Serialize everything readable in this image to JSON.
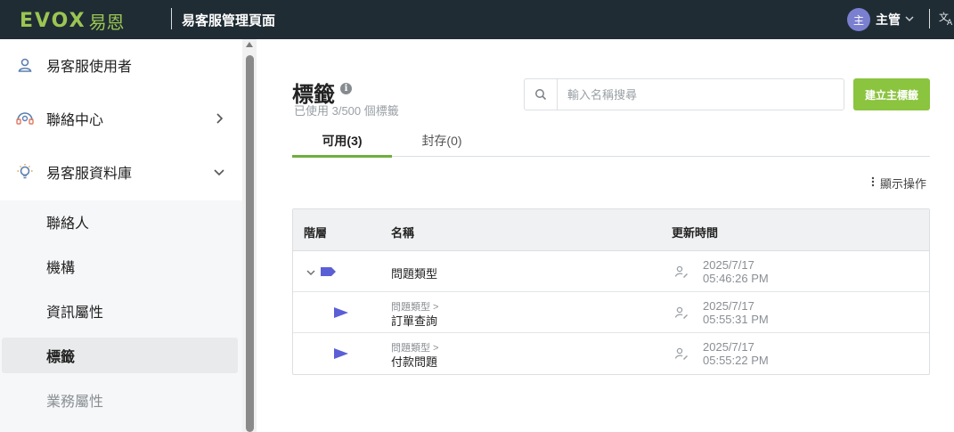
{
  "header": {
    "logo_brand": "EVOX",
    "logo_cn": "易恩",
    "app_title": "易客服管理頁面",
    "user_initial": "主",
    "user_name": "主管"
  },
  "sidebar": {
    "items": [
      {
        "label": "易客服使用者",
        "icon": "user-icon"
      },
      {
        "label": "聯絡中心",
        "icon": "headset-icon",
        "expandable": true,
        "expanded": false
      },
      {
        "label": "易客服資料庫",
        "icon": "lightbulb-icon",
        "expandable": true,
        "expanded": true
      }
    ],
    "subitems": [
      {
        "label": "聯絡人",
        "active": false
      },
      {
        "label": "機構",
        "active": false
      },
      {
        "label": "資訊屬性",
        "active": false
      },
      {
        "label": "標籤",
        "active": true
      },
      {
        "label": "業務屬性",
        "active": false,
        "muted": true
      }
    ]
  },
  "main": {
    "title": "標籤",
    "usage_text": "已使用 3/500 個標籤",
    "search_placeholder": "輸入名稱搜尋",
    "create_button": "建立主標籤",
    "tabs": [
      {
        "label": "可用(3)",
        "active": true
      },
      {
        "label": "封存(0)",
        "active": false
      }
    ],
    "actions_label": "顯示操作",
    "table": {
      "columns": [
        "階層",
        "名稱",
        "更新時間"
      ],
      "rows": [
        {
          "level": 0,
          "path": "",
          "name": "問題類型",
          "date": "2025/7/17",
          "time": "05:46:26 PM"
        },
        {
          "level": 1,
          "path": "問題類型 >",
          "name": "訂單查詢",
          "date": "2025/7/17",
          "time": "05:55:31 PM"
        },
        {
          "level": 1,
          "path": "問題類型 >",
          "name": "付款問題",
          "date": "2025/7/17",
          "time": "05:55:22 PM"
        }
      ]
    }
  },
  "colors": {
    "topbar": "#1f2c34",
    "brand_green": "#9bc552",
    "accent_green": "#8bc43f",
    "tag_purple": "#5b5fd6",
    "avatar": "#7a7fd0"
  }
}
